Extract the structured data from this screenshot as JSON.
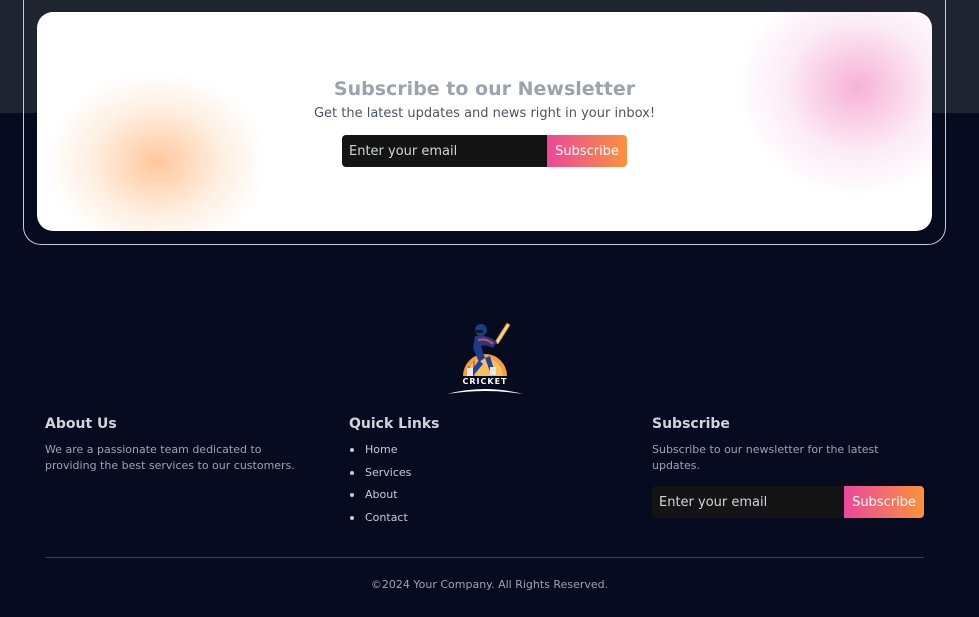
{
  "newsletter": {
    "title": "Subscribe to our Newsletter",
    "subtitle": "Get the latest updates and news right in your inbox!",
    "email_placeholder": "Enter your email",
    "button_label": "Subscribe"
  },
  "logo": {
    "text": "CRICKET",
    "icon": "cricket-batsman-icon"
  },
  "footer": {
    "about": {
      "heading": "About Us",
      "text": "We are a passionate team dedicated to providing the best services to our customers."
    },
    "quick_links": {
      "heading": "Quick Links",
      "items": [
        "Home",
        "Services",
        "About",
        "Contact"
      ]
    },
    "subscribe": {
      "heading": "Subscribe",
      "text": "Subscribe to our newsletter for the latest updates.",
      "email_placeholder": "Enter your email",
      "button_label": "Subscribe"
    },
    "copyright": "©2024 Your Company. All Rights Reserved."
  },
  "colors": {
    "page_background": "#070b1f",
    "top_band": "#1e2430",
    "button_gradient_start": "#ec4899",
    "button_gradient_end": "#fb923c"
  }
}
